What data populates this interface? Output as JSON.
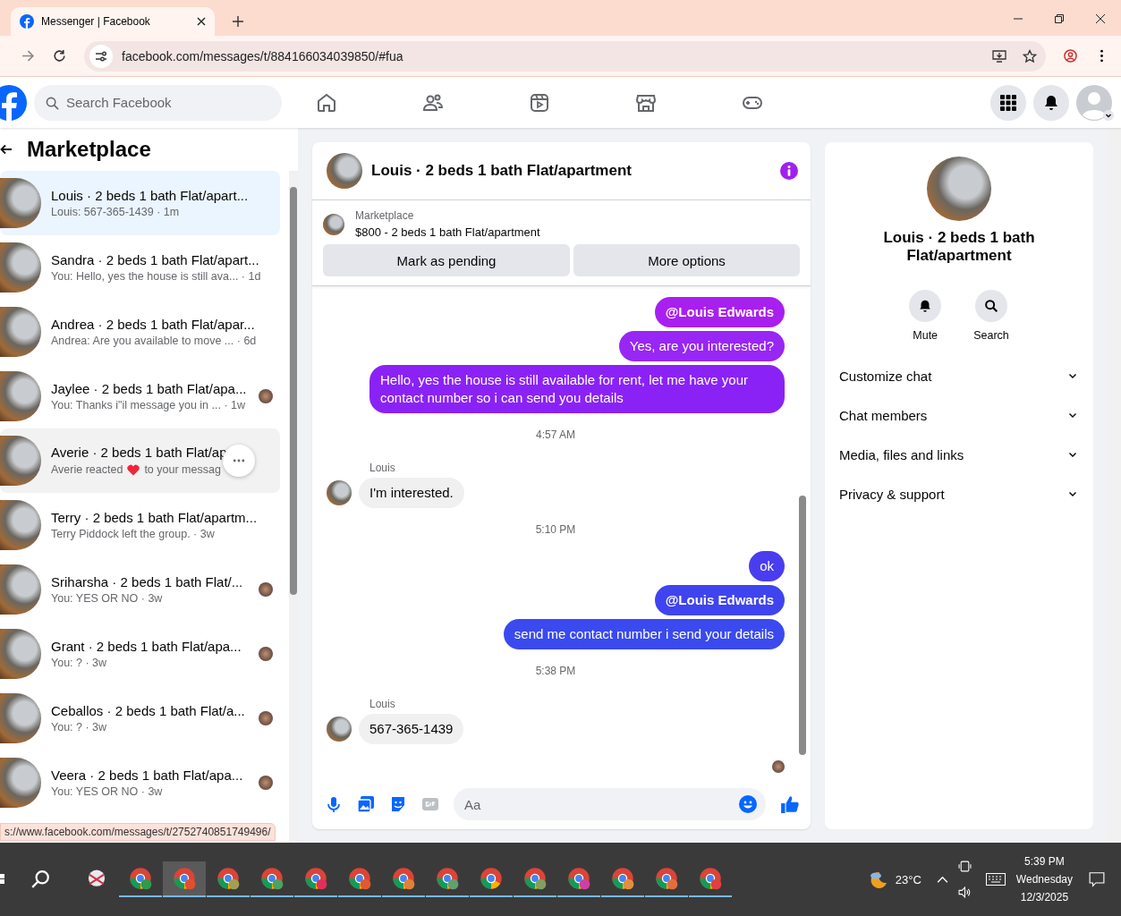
{
  "browser": {
    "tab_title": "Messenger | Facebook",
    "url": "facebook.com/messages/t/884166034039850/#fua"
  },
  "topbar": {
    "search_placeholder": "Search Facebook"
  },
  "sidebar": {
    "title": "Marketplace",
    "conversations": [
      {
        "kind": "text",
        "name": "Louis · 2 beds 1 bath Flat/apart...",
        "preview": "Louis: 567-365-1439 · 1m",
        "selected": true,
        "hovered": false,
        "seen_avatar": false
      },
      {
        "kind": "text",
        "name": "Sandra · 2 beds 1 bath Flat/apart...",
        "preview": "You: Hello, yes the house is still ava... · 1d",
        "selected": false,
        "hovered": false,
        "seen_avatar": false
      },
      {
        "kind": "text",
        "name": "Andrea · 2 beds 1 bath Flat/apar...",
        "preview": "Andrea: Are you available to move ... · 6d",
        "selected": false,
        "hovered": false,
        "seen_avatar": false
      },
      {
        "kind": "text",
        "name": "Jaylee · 2 beds 1 bath Flat/apa...",
        "preview": "You: Thanks i\"il message you in ... · 1w",
        "selected": false,
        "hovered": false,
        "seen_avatar": true
      },
      {
        "kind": "reaction",
        "name": "Averie · 2 beds 1 bath Flat/ap",
        "preview": "Averie reacted",
        "preview_after": "to your messag",
        "selected": false,
        "hovered": true,
        "seen_avatar": false
      },
      {
        "kind": "text",
        "name": "Terry · 2 beds 1 bath Flat/apartm...",
        "preview": "Terry Piddock left the group. · 3w",
        "selected": false,
        "hovered": false,
        "seen_avatar": false
      },
      {
        "kind": "text",
        "name": "Sriharsha · 2 beds 1 bath Flat/...",
        "preview": "You: YES OR NO · 3w",
        "selected": false,
        "hovered": false,
        "seen_avatar": true
      },
      {
        "kind": "text",
        "name": "Grant · 2 beds 1 bath Flat/apa...",
        "preview": "You: ? · 3w",
        "selected": false,
        "hovered": false,
        "seen_avatar": true
      },
      {
        "kind": "text",
        "name": "Ceballos · 2 beds 1 bath Flat/a...",
        "preview": "You: ? · 3w",
        "selected": false,
        "hovered": false,
        "seen_avatar": true
      },
      {
        "kind": "text",
        "name": "Veera · 2 beds 1 bath Flat/apa...",
        "preview": "You: YES OR NO · 3w",
        "selected": false,
        "hovered": false,
        "seen_avatar": true
      }
    ],
    "status_url": "s://www.facebook.com/messages/t/2752740851749496/"
  },
  "chat": {
    "title": "Louis · 2 beds 1 bath Flat/apartment",
    "listing": {
      "label": "Marketplace",
      "price_title": "$800 - 2 beds 1 bath Flat/apartment"
    },
    "actions": [
      "Mark as pending",
      "More options"
    ],
    "messages": [
      {
        "kind": "outgoing",
        "text": "@Louis Edwards",
        "mention": true,
        "color": "#a81ff0"
      },
      {
        "kind": "outgoing",
        "text": "Yes, are you interested?",
        "mention": false,
        "color": "#9826f4"
      },
      {
        "kind": "outgoing",
        "text": "Hello, yes the house is still available for rent, let me have your contact number so i can send you details",
        "mention": false,
        "color": "#8a22f6"
      },
      {
        "kind": "time",
        "text": "4:57 AM"
      },
      {
        "kind": "incoming",
        "sender": "Louis",
        "text": "I'm interested."
      },
      {
        "kind": "time",
        "text": "5:10 PM"
      },
      {
        "kind": "outgoing",
        "text": "ok",
        "mention": false,
        "color": "#4a3df0"
      },
      {
        "kind": "outgoing",
        "text": "@Louis Edwards",
        "mention": true,
        "color": "#3f44ef"
      },
      {
        "kind": "outgoing",
        "text": "send me contact number i send your details",
        "mention": false,
        "color": "#3a4aee"
      },
      {
        "kind": "time",
        "text": "5:38 PM"
      },
      {
        "kind": "incoming",
        "sender": "Louis",
        "text": "567-365-1439"
      }
    ],
    "composer_placeholder": "Aa"
  },
  "details": {
    "title": "Louis · 2 beds 1 bath Flat/apartment",
    "quick_actions": [
      "Mute",
      "Search"
    ],
    "sections": [
      {
        "label": "Customize chat",
        "expanded": false
      },
      {
        "label": "Chat members",
        "expanded": false
      },
      {
        "label": "Media, files and links",
        "expanded": false
      },
      {
        "label": "Privacy & support",
        "expanded": false
      }
    ]
  },
  "taskbar": {
    "apps": [
      {
        "kind": "snip",
        "selected": false
      },
      {
        "kind": "browser",
        "selected": false,
        "color": "#2e9a4a"
      },
      {
        "kind": "browser",
        "selected": true,
        "color": "#e05030"
      },
      {
        "kind": "browser",
        "selected": false,
        "color": "#a0a050"
      },
      {
        "kind": "browser",
        "selected": false,
        "color": "#50a060"
      },
      {
        "kind": "browser",
        "selected": false,
        "color": "#e0305a"
      },
      {
        "kind": "browser",
        "selected": false,
        "color": "#e05a30"
      },
      {
        "kind": "browser",
        "selected": false,
        "color": "#e0803a"
      },
      {
        "kind": "browser",
        "selected": false,
        "color": "#60a070"
      },
      {
        "kind": "plain",
        "selected": false
      },
      {
        "kind": "browser",
        "selected": false,
        "color": "#80a060"
      },
      {
        "kind": "browser",
        "selected": false,
        "color": "#d040a0"
      },
      {
        "kind": "browser",
        "selected": false,
        "color": "#e09040"
      },
      {
        "kind": "browser",
        "selected": false,
        "color": "#e07040"
      },
      {
        "kind": "browser",
        "selected": false,
        "color": "#e04040"
      }
    ],
    "weather": "23°C",
    "time": "5:39 PM",
    "day": "Wednesday",
    "date": "12/3/2025"
  }
}
